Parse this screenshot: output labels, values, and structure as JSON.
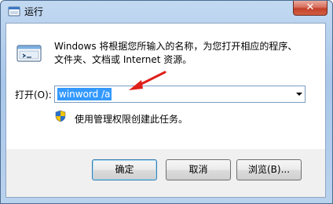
{
  "window": {
    "title": "运行",
    "close_label": "✕"
  },
  "description": {
    "line1": "Windows 将根据您所输入的名称，为您打开相应的程序、",
    "line2": "文件夹、文档或 Internet 资源。"
  },
  "open_field": {
    "label": "打开(O):",
    "value": "winword /a"
  },
  "admin_note": "使用管理权限创建此任务。",
  "buttons": {
    "ok": "确定",
    "cancel": "取消",
    "browse": "浏览(B)..."
  },
  "colors": {
    "selection": "#3399ff",
    "annotation_arrow": "#e0201b",
    "close_button": "#c2412a"
  }
}
